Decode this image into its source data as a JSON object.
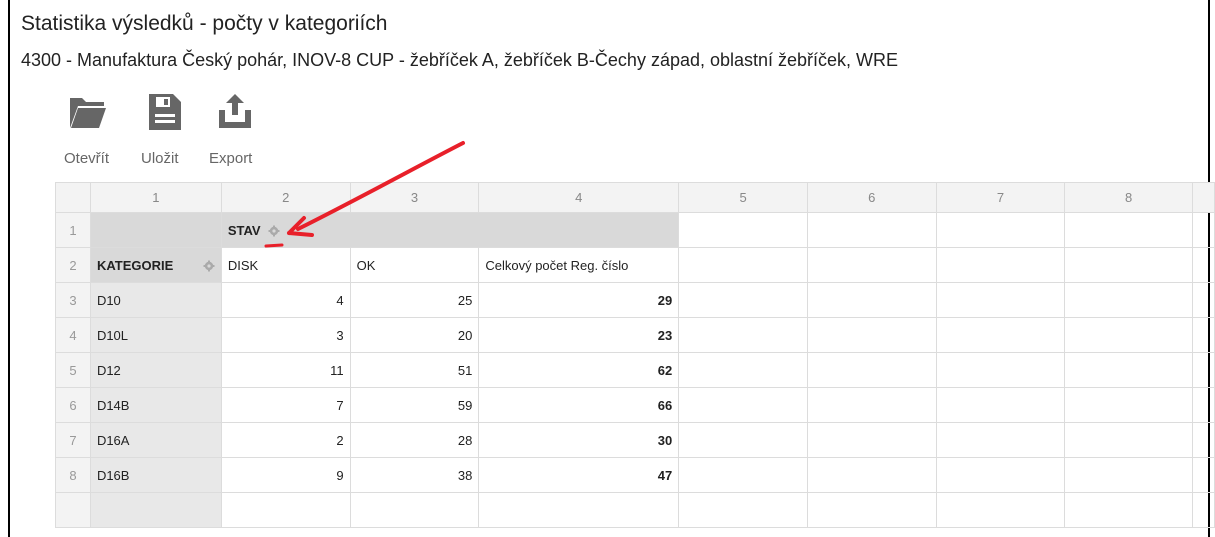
{
  "page": {
    "title": "Statistika výsledků - počty v kategoriích",
    "subtitle": "4300 - Manufaktura Český pohár, INOV-8 CUP - žebříček A, žebříček B-Čechy západ, oblastní žebříček, WRE"
  },
  "toolbar": {
    "open_label": "Otevřít",
    "save_label": "Uložit",
    "export_label": "Export"
  },
  "grid": {
    "col_headers": [
      "1",
      "2",
      "3",
      "4",
      "5",
      "6",
      "7",
      "8"
    ],
    "row_numbers": [
      "1",
      "2",
      "3",
      "4",
      "5",
      "6",
      "7",
      "8"
    ],
    "pivot_column_field": "STAV",
    "pivot_row_field": "KATEGORIE",
    "value_headers": [
      "DISK",
      "OK",
      "Celkový počet Reg. číslo"
    ],
    "rows": [
      {
        "cat": "D10",
        "disk": "4",
        "ok": "25",
        "total": "29"
      },
      {
        "cat": "D10L",
        "disk": "3",
        "ok": "20",
        "total": "23"
      },
      {
        "cat": "D12",
        "disk": "11",
        "ok": "51",
        "total": "62"
      },
      {
        "cat": "D14B",
        "disk": "7",
        "ok": "59",
        "total": "66"
      },
      {
        "cat": "D16A",
        "disk": "2",
        "ok": "28",
        "total": "30"
      },
      {
        "cat": "D16B",
        "disk": "9",
        "ok": "38",
        "total": "47"
      }
    ]
  },
  "colors": {
    "annotation": "#e8202a",
    "pivot_header_bg": "#d9d9d9",
    "header_bg": "#f3f3f3",
    "icon_gray": "#666666"
  }
}
